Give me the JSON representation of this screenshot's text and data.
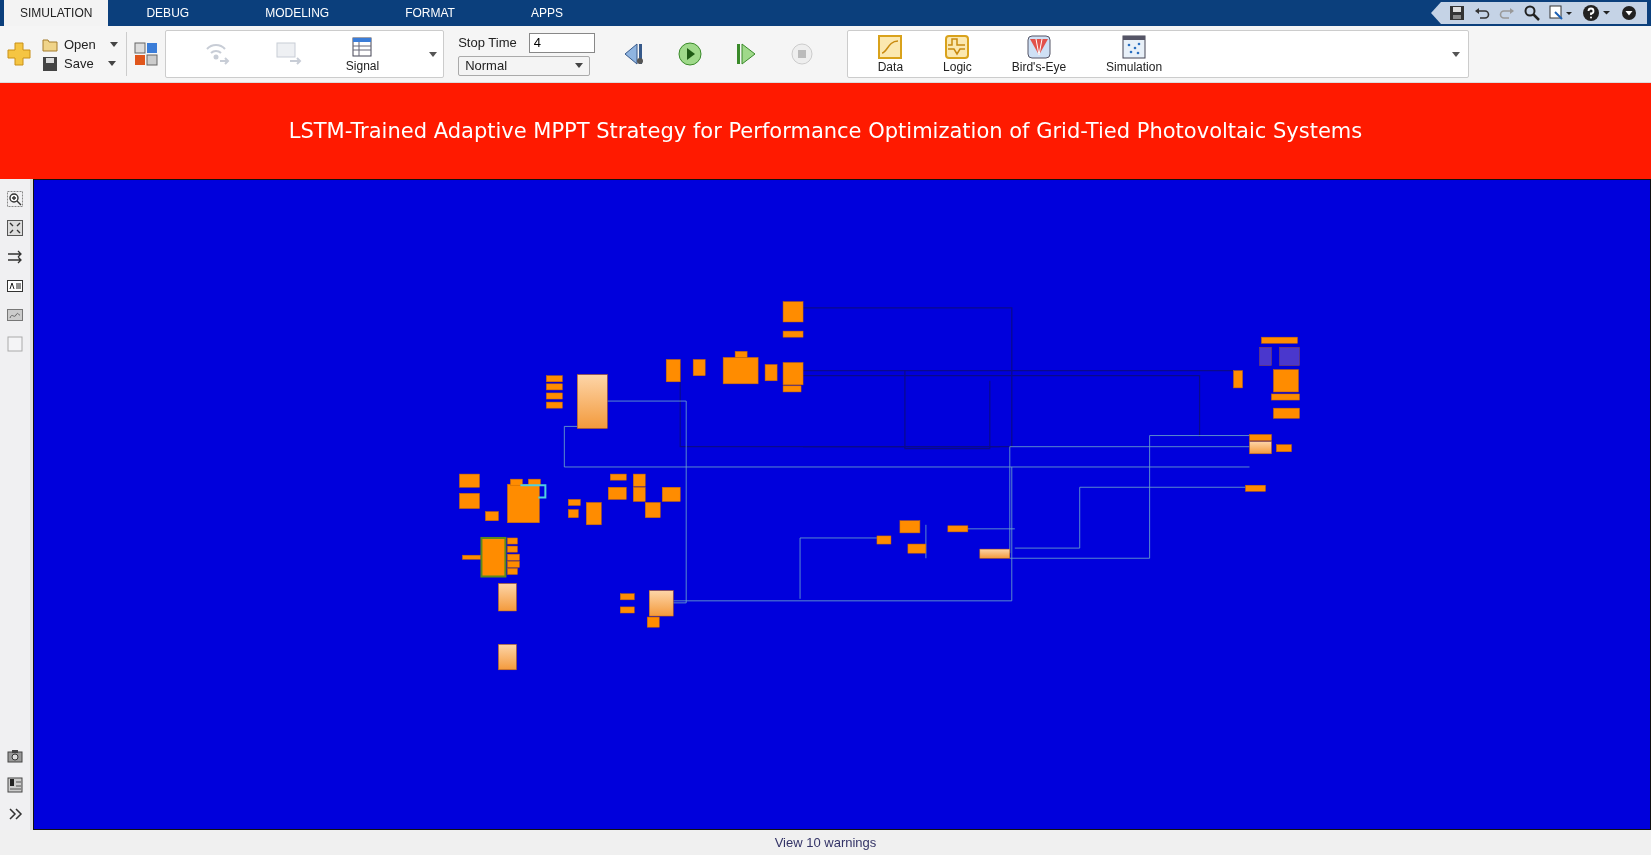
{
  "tabs": [
    {
      "label": "SIMULATION",
      "selected": true
    },
    {
      "label": "DEBUG",
      "selected": false
    },
    {
      "label": "MODELING",
      "selected": false
    },
    {
      "label": "FORMAT",
      "selected": false
    },
    {
      "label": "APPS",
      "selected": false
    }
  ],
  "toolbar": {
    "open_label": "Open",
    "save_label": "Save",
    "signal_label": "Signal",
    "stop_time_label": "Stop Time",
    "stop_time_value": "4",
    "mode_value": "Normal",
    "review_tools": [
      {
        "label": "Data",
        "kind": "data"
      },
      {
        "label": "Logic",
        "kind": "logic"
      },
      {
        "label": "Bird's-Eye",
        "kind": "birdseye"
      },
      {
        "label": "Simulation",
        "kind": "simulation"
      }
    ]
  },
  "banner": {
    "title": "LSTM-Trained Adaptive MPPT Strategy for Performance Optimization of Grid-Tied Photovoltaic Systems"
  },
  "status_bar": {
    "warnings_link": "View 10 warnings"
  }
}
